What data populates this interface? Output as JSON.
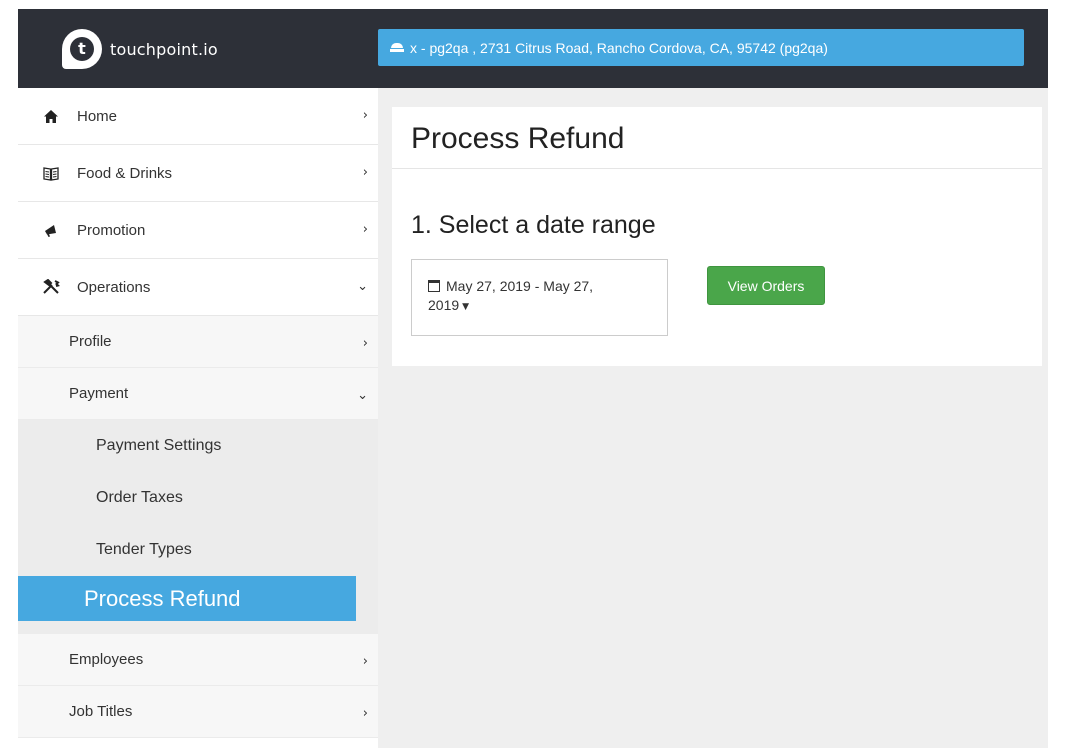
{
  "header": {
    "brand_letter": "t",
    "brand_name": "touchpoint.io",
    "location": "x - pg2qa , 2731 Citrus Road, Rancho Cordova, CA, 95742 (pg2qa)"
  },
  "sidebar": {
    "items": [
      {
        "label": "Home",
        "icon": "home-icon",
        "chevron": "›"
      },
      {
        "label": "Food & Drinks",
        "icon": "menu-book-icon",
        "chevron": "›"
      },
      {
        "label": "Promotion",
        "icon": "megaphone-icon",
        "chevron": "›"
      },
      {
        "label": "Operations",
        "icon": "tools-icon",
        "chevron": "⌄"
      }
    ],
    "operations_sub": [
      {
        "label": "Profile",
        "chevron": "›"
      },
      {
        "label": "Payment",
        "chevron": "⌄"
      }
    ],
    "payment_sub": [
      {
        "label": "Payment Settings"
      },
      {
        "label": "Order Taxes"
      },
      {
        "label": "Tender Types"
      },
      {
        "label": "Process Refund",
        "active": true
      }
    ],
    "operations_sub_after": [
      {
        "label": "Employees",
        "chevron": "›"
      },
      {
        "label": "Job Titles",
        "chevron": "›"
      }
    ]
  },
  "main": {
    "title": "Process Refund",
    "section_title": "1. Select a date range",
    "date_range": {
      "line1": "May 27, 2019 - May 27,",
      "line2": "2019"
    },
    "view_orders_label": "View Orders"
  },
  "colors": {
    "header_bg": "#2d3038",
    "accent_blue": "#46a8e0",
    "button_green": "#4aa64a",
    "content_bg": "#efefef"
  }
}
